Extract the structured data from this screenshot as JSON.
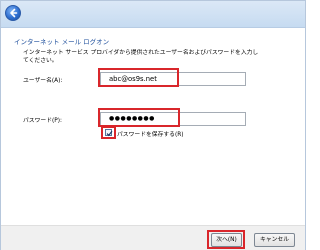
{
  "dialog": {
    "heading": "インターネット メール ログオン",
    "instruction": "インターネット サービス プロバイダから提供されたユーザー名およびパスワードを入力してください。"
  },
  "form": {
    "username_label": "ユーザー名(A):",
    "username_value": "abc@os9s.net",
    "password_label": "パスワード(P):",
    "password_value": "●●●●●●●●",
    "remember_label": "パスワードを保存する(R)",
    "remember_checked": true
  },
  "buttons": {
    "next_label": "次へ(N)",
    "cancel_label": "キャンセル"
  },
  "colors": {
    "heading": "#1e4f9c",
    "highlight": "#d9262b"
  },
  "icons": {
    "back": "back-arrow-icon",
    "check": "checkmark-icon"
  }
}
